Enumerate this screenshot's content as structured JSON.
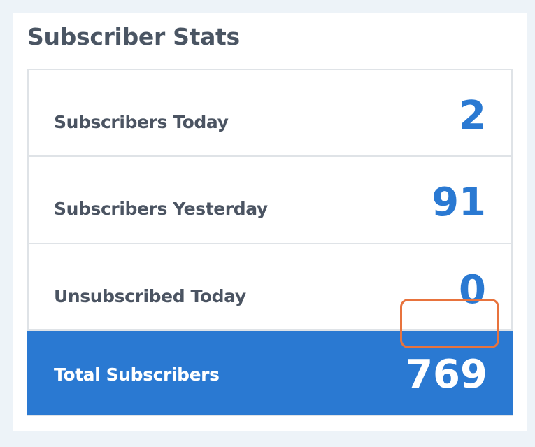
{
  "widget": {
    "title": "Subscriber Stats",
    "colors": {
      "accent": "#2a79d2",
      "highlight": "#e8733d",
      "label": "#4b5462",
      "border": "#dfe3e7",
      "background": "#edf3f8"
    },
    "stats": [
      {
        "label": "Subscribers Today",
        "value": "2"
      },
      {
        "label": "Subscribers Yesterday",
        "value": "91"
      },
      {
        "label": "Unsubscribed Today",
        "value": "0"
      }
    ],
    "total": {
      "label": "Total Subscribers",
      "value": "769"
    }
  }
}
